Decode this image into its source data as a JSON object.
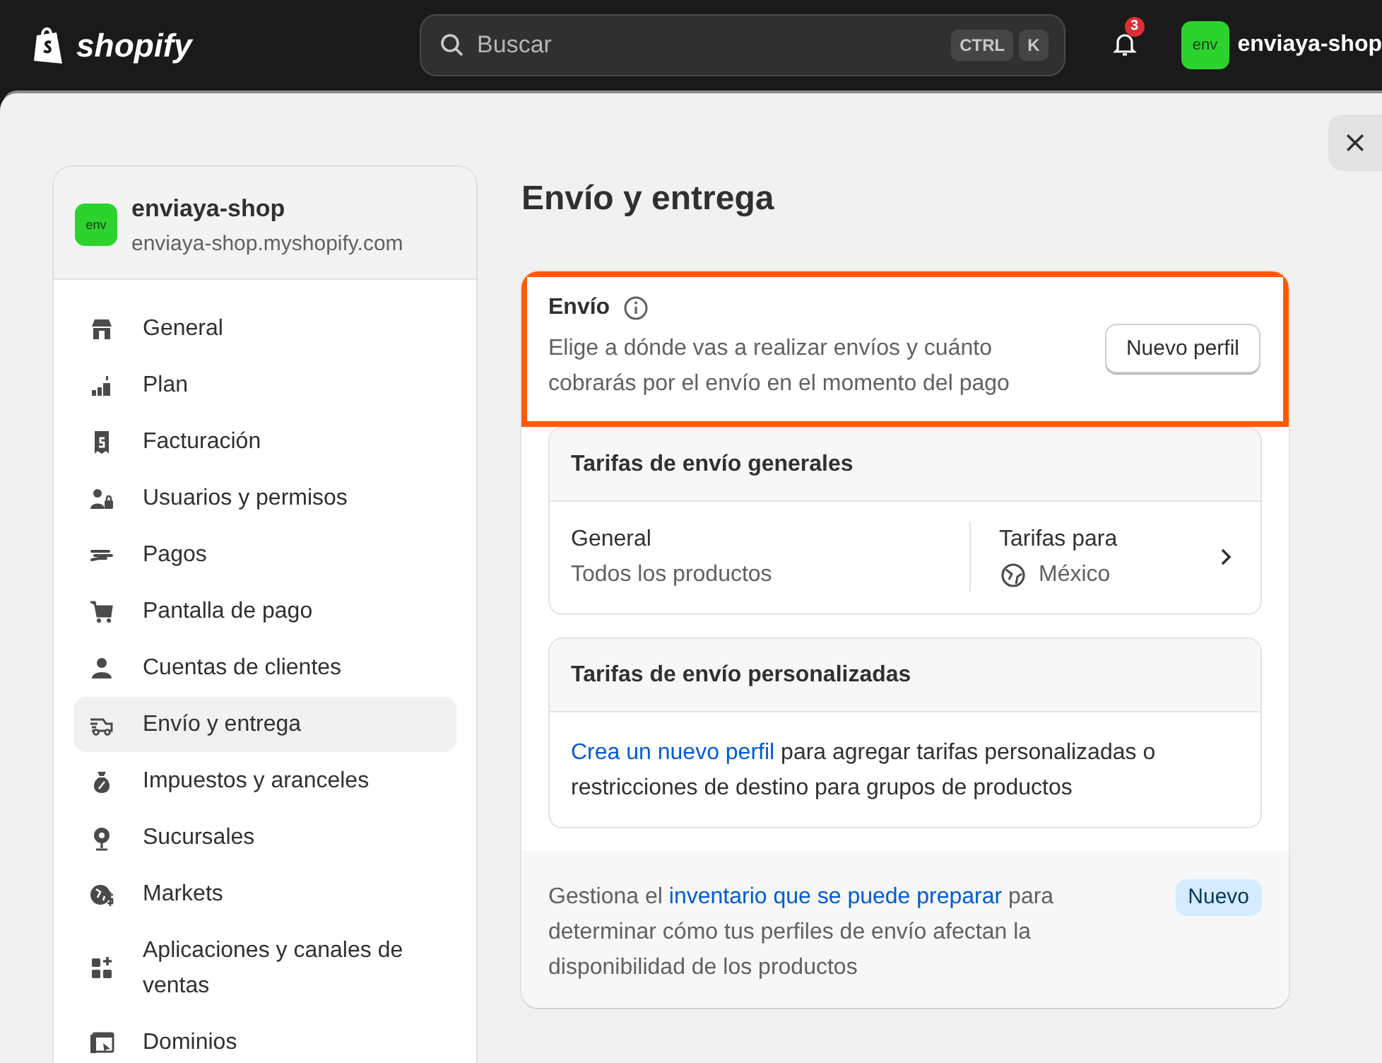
{
  "topbar": {
    "logo": "shopify",
    "search": {
      "placeholder": "Buscar",
      "keys": [
        "CTRL",
        "K"
      ]
    },
    "notifications": {
      "count": "3"
    },
    "store": {
      "avatar": "env",
      "name": "enviaya-shop"
    }
  },
  "sidebar": {
    "store": {
      "avatar": "env",
      "name": "enviaya-shop",
      "domain": "enviaya-shop.myshopify.com"
    },
    "items": [
      {
        "label": "General",
        "selected": false
      },
      {
        "label": "Plan",
        "selected": false
      },
      {
        "label": "Facturación",
        "selected": false
      },
      {
        "label": "Usuarios y permisos",
        "selected": false
      },
      {
        "label": "Pagos",
        "selected": false
      },
      {
        "label": "Pantalla de pago",
        "selected": false
      },
      {
        "label": "Cuentas de clientes",
        "selected": false
      },
      {
        "label": "Envío y entrega",
        "selected": true
      },
      {
        "label": "Impuestos y aranceles",
        "selected": false
      },
      {
        "label": "Sucursales",
        "selected": false
      },
      {
        "label": "Markets",
        "selected": false
      },
      {
        "label": "Aplicaciones y canales de ventas",
        "selected": false
      },
      {
        "label": "Dominios",
        "selected": false
      }
    ]
  },
  "page": {
    "title": "Envío y entrega",
    "shipping": {
      "title": "Envío",
      "description": "Elige a dónde vas a realizar envíos y cuánto cobrarás por el envío en el momento del pago",
      "button": "Nuevo perfil",
      "highlighted": true,
      "general_rates": {
        "title": "Tarifas de envío generales",
        "profile": "General",
        "products": "Todos los productos",
        "rates_label": "Tarifas para",
        "zone": "México"
      },
      "custom_rates": {
        "title": "Tarifas de envío personalizadas",
        "link": "Crea un nuevo perfil",
        "text": " para agregar tarifas personalizadas o restricciones de destino para grupos de productos"
      },
      "footer": {
        "before": "Gestiona el ",
        "link": "inventario que se puede preparar",
        "after": " para determinar cómo tus perfiles de envío afectan la disponibilidad de los productos",
        "badge": "Nuevo"
      }
    }
  }
}
